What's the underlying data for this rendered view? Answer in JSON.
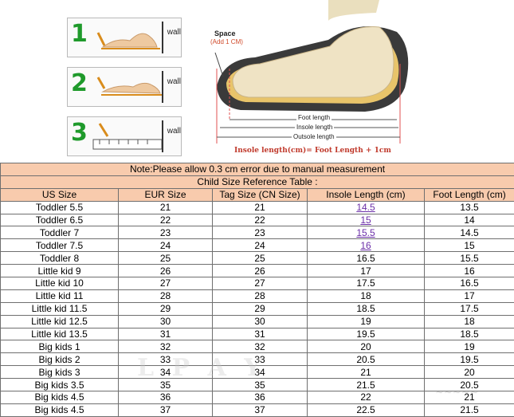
{
  "diagram": {
    "steps": [
      {
        "number": "1",
        "wall_label": "wall"
      },
      {
        "number": "2",
        "wall_label": "wall"
      },
      {
        "number": "3",
        "wall_label": "wall"
      }
    ],
    "space_label": "Space",
    "space_sub": "(Add 1 CM)",
    "foot_length_label": "Foot length",
    "insole_length_label": "Insole length",
    "outsole_length_label": "Outsole length",
    "formula": "Insole length(cm)= Foot Length + 1cm"
  },
  "note": "Note:Please allow 0.3 cm error due to manual measurement",
  "table_title": "Child Size Reference Table :",
  "columns": [
    "US Size",
    "EUR Size",
    "Tag Size (CN Size)",
    "Insole Length (cm)",
    "Foot Length (cm)"
  ],
  "rows": [
    [
      "Toddler 5.5",
      "21",
      "21",
      "14.5",
      "13.5"
    ],
    [
      "Toddler 6.5",
      "22",
      "22",
      "15",
      "14"
    ],
    [
      "Toddler 7",
      "23",
      "23",
      "15.5",
      "14.5"
    ],
    [
      "Toddler 7.5",
      "24",
      "24",
      "16",
      "15"
    ],
    [
      "Toddler 8",
      "25",
      "25",
      "16.5",
      "15.5"
    ],
    [
      "Little kid 9",
      "26",
      "26",
      "17",
      "16"
    ],
    [
      "Little kid 10",
      "27",
      "27",
      "17.5",
      "16.5"
    ],
    [
      "Little kid 11",
      "28",
      "28",
      "18",
      "17"
    ],
    [
      "Little kid 11.5",
      "29",
      "29",
      "18.5",
      "17.5"
    ],
    [
      "Little kid 12.5",
      "30",
      "30",
      "19",
      "18"
    ],
    [
      "Little kid 13.5",
      "31",
      "31",
      "19.5",
      "18.5"
    ],
    [
      "Big kids 1",
      "32",
      "32",
      "20",
      "19"
    ],
    [
      "Big kids 2",
      "33",
      "33",
      "20.5",
      "19.5"
    ],
    [
      "Big kids 3",
      "34",
      "34",
      "21",
      "20"
    ],
    [
      "Big kids 3.5",
      "35",
      "35",
      "21.5",
      "20.5"
    ],
    [
      "Big kids 4.5",
      "36",
      "36",
      "22",
      "21"
    ],
    [
      "Big kids 4.5",
      "37",
      "37",
      "22.5",
      "21.5"
    ]
  ],
  "colors": {
    "band": "#f8cbad",
    "step_number": "#1f9a2b",
    "link": "#6b2ea8",
    "formula": "#c0392b"
  }
}
